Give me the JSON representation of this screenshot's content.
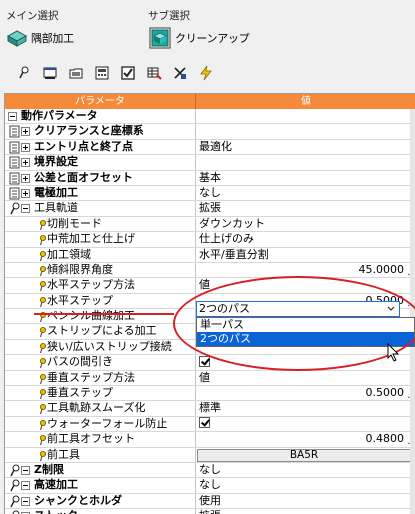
{
  "main_select": {
    "label": "メイン選択",
    "value": "隅部加工"
  },
  "sub_select": {
    "label": "サブ選択",
    "value": "クリーンアップ"
  },
  "toolbar": [
    "pin-icon",
    "window-icon",
    "folder-icon",
    "calculator-icon",
    "checkbox-icon",
    "grid-icon",
    "tool-icon",
    "bolt-icon"
  ],
  "header": {
    "param": "パラメータ",
    "value": "値"
  },
  "rows": [
    {
      "label": "動作パラメータ",
      "value": "",
      "indent": 0,
      "toggle": "minus",
      "icon": "none",
      "group": true
    },
    {
      "label": "クリアランスと座標系",
      "value": "",
      "indent": 1,
      "toggle": "plus",
      "icon": "page",
      "group": true
    },
    {
      "label": "エントリ点と終了点",
      "value": "最適化",
      "indent": 1,
      "toggle": "plus",
      "icon": "page",
      "group": true
    },
    {
      "label": "境界設定",
      "value": "",
      "indent": 1,
      "toggle": "plus",
      "icon": "page",
      "group": true
    },
    {
      "label": "公差と面オフセット",
      "value": "基本",
      "indent": 1,
      "toggle": "plus",
      "icon": "page",
      "group": true
    },
    {
      "label": "電極加工",
      "value": "なし",
      "indent": 1,
      "toggle": "plus",
      "icon": "page",
      "group": true
    },
    {
      "label": "工具軌道",
      "value": "拡張",
      "indent": 1,
      "toggle": "minus",
      "icon": "pin",
      "group": false
    },
    {
      "label": "切削モード",
      "value": "ダウンカット",
      "indent": 3,
      "toggle": "none",
      "icon": "dot",
      "group": false
    },
    {
      "label": "中荒加工と仕上げ",
      "value": "仕上げのみ",
      "indent": 3,
      "toggle": "none",
      "icon": "dot",
      "group": false
    },
    {
      "label": "加工領域",
      "value": "水平/垂直分割",
      "indent": 3,
      "toggle": "none",
      "icon": "dot",
      "group": false
    },
    {
      "label": "傾斜限界角度",
      "value": "45.0000",
      "indent": 3,
      "toggle": "none",
      "icon": "dot",
      "group": false,
      "num": true
    },
    {
      "label": "水平ステップ方法",
      "value": "値",
      "indent": 3,
      "toggle": "none",
      "icon": "dot",
      "group": false
    },
    {
      "label": "水平ステップ",
      "value": "0.5000",
      "indent": 3,
      "toggle": "none",
      "icon": "dot",
      "group": false,
      "num": true
    },
    {
      "label": "ペンシル曲線加工",
      "value": "",
      "indent": 3,
      "toggle": "none",
      "icon": "dot",
      "group": false
    },
    {
      "label": "ストリップによる加工",
      "value": "",
      "indent": 3,
      "toggle": "none",
      "icon": "dot",
      "group": false
    },
    {
      "label": "狭い/広いストリップ接続",
      "value": "",
      "indent": 3,
      "toggle": "none",
      "icon": "dot",
      "group": false
    },
    {
      "label": "パスの間引き",
      "value": "",
      "indent": 3,
      "toggle": "none",
      "icon": "dot",
      "group": false,
      "check": true
    },
    {
      "label": "垂直ステップ方法",
      "value": "値",
      "indent": 3,
      "toggle": "none",
      "icon": "dot",
      "group": false
    },
    {
      "label": "垂直ステップ",
      "value": "0.5000",
      "indent": 3,
      "toggle": "none",
      "icon": "dot",
      "group": false,
      "num": true
    },
    {
      "label": "工具軌跡スムーズ化",
      "value": "標準",
      "indent": 3,
      "toggle": "none",
      "icon": "dot",
      "group": false
    },
    {
      "label": "ウォーターフォール防止",
      "value": "",
      "indent": 3,
      "toggle": "none",
      "icon": "dot",
      "group": false,
      "check": true
    },
    {
      "label": "前工具オフセット",
      "value": "0.4800",
      "indent": 3,
      "toggle": "none",
      "icon": "dot",
      "group": false,
      "num": true
    },
    {
      "label": "前工具",
      "value": "BA5R",
      "indent": 3,
      "toggle": "none",
      "icon": "dot",
      "group": false,
      "button": true
    },
    {
      "label": "Z制限",
      "value": "なし",
      "indent": 1,
      "toggle": "minus",
      "icon": "pin",
      "group": true
    },
    {
      "label": "高速加工",
      "value": "なし",
      "indent": 1,
      "toggle": "minus",
      "icon": "pin",
      "group": true
    },
    {
      "label": "シャンクとホルダ",
      "value": "使用",
      "indent": 1,
      "toggle": "minus",
      "icon": "pin",
      "group": true
    },
    {
      "label": "ストック",
      "value": "拡張",
      "indent": 1,
      "toggle": "minus",
      "icon": "pin",
      "group": true
    }
  ],
  "dropdown": {
    "selected": "2つのパス",
    "options": [
      "単一パス",
      "2つのパス"
    ],
    "highlighted": 1
  },
  "colors": {
    "header": "#f58a3c",
    "highlight": "#0a64d6",
    "annotation": "#d81f26",
    "f_marker": "#1a5bd6"
  }
}
